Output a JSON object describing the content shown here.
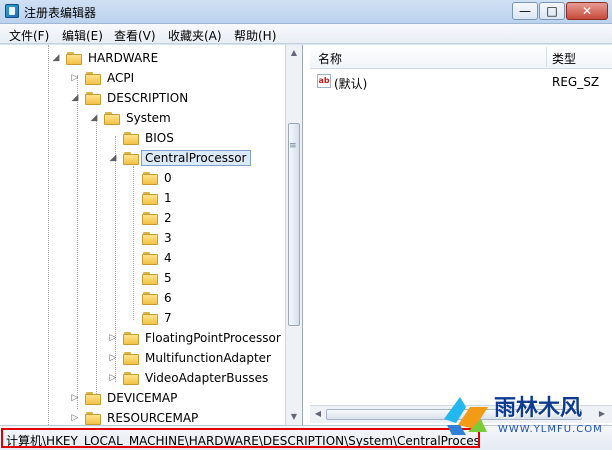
{
  "window": {
    "title": "注册表编辑器",
    "controls": [
      "—",
      "□",
      "✕"
    ]
  },
  "menu": [
    "文件(F)",
    "编辑(E)",
    "查看(V)",
    "收藏夹(A)",
    "帮助(H)"
  ],
  "tree": [
    {
      "label": "HARDWARE",
      "expander": "◢",
      "level": 0
    },
    {
      "label": "ACPI",
      "expander": "▷",
      "level": 1
    },
    {
      "label": "DESCRIPTION",
      "expander": "◢",
      "level": 1
    },
    {
      "label": "System",
      "expander": "◢",
      "level": 2
    },
    {
      "label": "BIOS",
      "expander": "",
      "level": 3
    },
    {
      "label": "CentralProcessor",
      "expander": "◢",
      "level": 3,
      "selected": true
    },
    {
      "label": "0",
      "expander": "",
      "level": 4
    },
    {
      "label": "1",
      "expander": "",
      "level": 4
    },
    {
      "label": "2",
      "expander": "",
      "level": 4
    },
    {
      "label": "3",
      "expander": "",
      "level": 4
    },
    {
      "label": "4",
      "expander": "",
      "level": 4
    },
    {
      "label": "5",
      "expander": "",
      "level": 4
    },
    {
      "label": "6",
      "expander": "",
      "level": 4
    },
    {
      "label": "7",
      "expander": "",
      "level": 4
    },
    {
      "label": "FloatingPointProcessor",
      "expander": "▷",
      "level": 3
    },
    {
      "label": "MultifunctionAdapter",
      "expander": "▷",
      "level": 3
    },
    {
      "label": "VideoAdapterBusses",
      "expander": "▷",
      "level": 3
    },
    {
      "label": "DEVICEMAP",
      "expander": "▷",
      "level": 1
    },
    {
      "label": "RESOURCEMAP",
      "expander": "▷",
      "level": 1
    }
  ],
  "list": {
    "headers": {
      "name": "名称",
      "type": "类型"
    },
    "rows": [
      {
        "icon": "ab",
        "name": "(默认)",
        "type": "REG_SZ"
      }
    ]
  },
  "status": {
    "path": "计算机\\HKEY_LOCAL_MACHINE\\HARDWARE\\DESCRIPTION\\System\\CentralProcessor"
  },
  "watermark": {
    "main": "雨林木风",
    "sub": "WWW.YLMFU.COM"
  },
  "colors": {
    "titlebar": "#bcd3ee",
    "highlight": "#e00000",
    "selected": "#dce9f7"
  },
  "icons": {
    "app": "registry-editor-icon",
    "folder": "folder-icon",
    "value": "string-value-icon"
  }
}
